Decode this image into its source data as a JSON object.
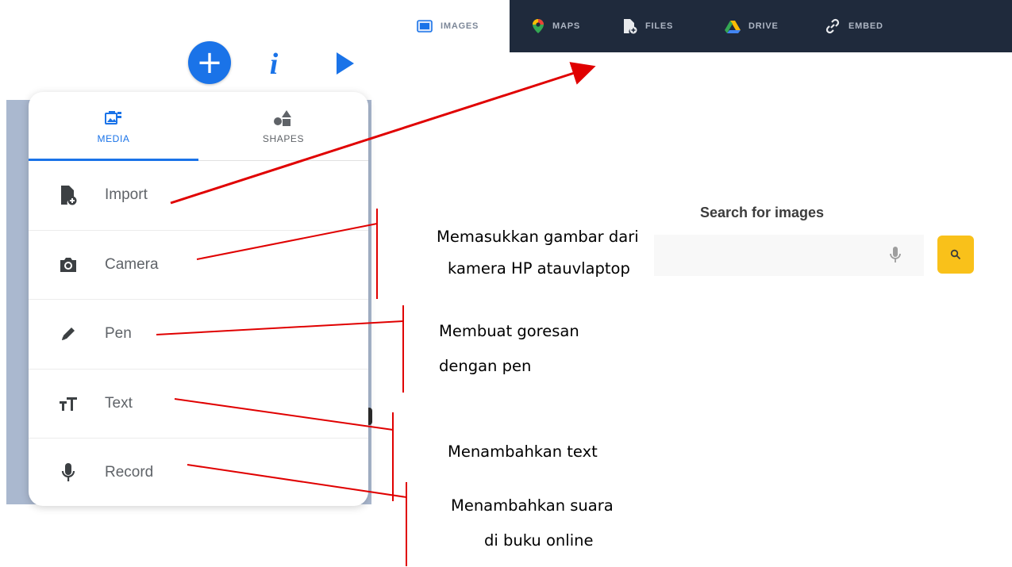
{
  "toolbar": {
    "plus_label": "+",
    "info_label": "i",
    "plus_icon": "plus-icon",
    "info_icon": "info-icon",
    "play_icon": "play-icon",
    "accent_color": "#1a73e8"
  },
  "panel": {
    "tabs": [
      {
        "label": "MEDIA",
        "icon": "media-icon",
        "active": true
      },
      {
        "label": "SHAPES",
        "icon": "shapes-icon",
        "active": false
      }
    ],
    "items": [
      {
        "label": "Import",
        "icon": "import-file-icon"
      },
      {
        "label": "Camera",
        "icon": "camera-icon"
      },
      {
        "label": "Pen",
        "icon": "pen-icon"
      },
      {
        "label": "Text",
        "icon": "text-size-icon"
      },
      {
        "label": "Record",
        "icon": "microphone-icon"
      }
    ]
  },
  "topbar": {
    "background": "#1f2a3c",
    "tabs": [
      {
        "label": "IMAGES",
        "icon": "images-icon",
        "active": true
      },
      {
        "label": "MAPS",
        "icon": "map-pin-icon",
        "active": false
      },
      {
        "label": "FILES",
        "icon": "file-add-icon",
        "active": false
      },
      {
        "label": "DRIVE",
        "icon": "drive-icon",
        "active": false
      },
      {
        "label": "EMBED",
        "icon": "link-icon",
        "active": false
      }
    ]
  },
  "search": {
    "title": "Search for images",
    "mic_icon": "microphone-icon",
    "button_icon": "search-icon",
    "button_color": "#f9c11a"
  },
  "annotations": {
    "camera_line1": "Memasukkan gambar dari",
    "camera_line2": "kamera HP atauvlaptop",
    "pen_line1": "Membuat goresan",
    "pen_line2": "dengan pen",
    "text_line1": "Menambahkan text",
    "record_line1": "Menambahkan suara",
    "record_line2": "di buku online",
    "line_color": "#e00000"
  }
}
